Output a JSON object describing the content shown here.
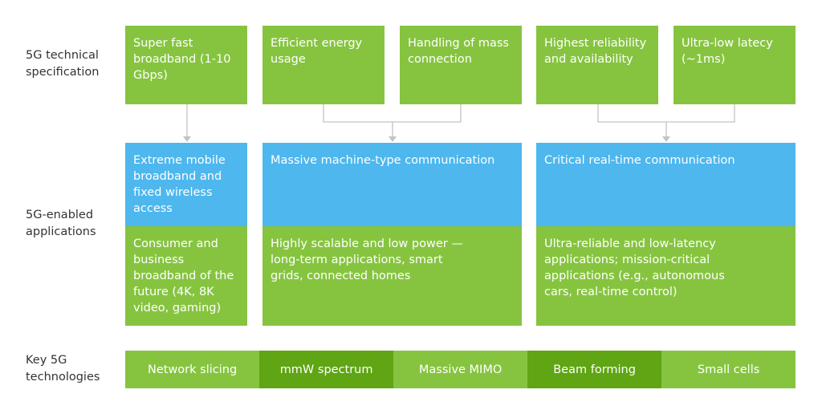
{
  "row_labels": {
    "spec": "5G technical specification",
    "apps": "5G-enabled applications",
    "tech": "Key 5G technologies"
  },
  "specs": [
    "Super fast broadband (1-10 Gbps)",
    "Efficient energy usage",
    "Handling of mass connection",
    "Highest reliability and availability",
    "Ultra-low latecy (~1ms)"
  ],
  "applications": [
    {
      "title": "Extreme mobile broadband and fixed wireless access",
      "detail": "Consumer and business broadband of the future (4K, 8K video, gaming)"
    },
    {
      "title": "Massive machine-type communication",
      "detail": "Highly scalable and low power — long-term applications, smart grids, connected homes"
    },
    {
      "title": "Critical real-time communication",
      "detail": "Ultra-reliable and low-latency applications; mission-critical applications (e.g., autonomous cars, real-time control)"
    }
  ],
  "technologies": [
    "Network slicing",
    "mmW spectrum",
    "Massive MIMO",
    "Beam forming",
    "Small cells"
  ],
  "colors": {
    "green": "#86c440",
    "dark_green": "#5fa514",
    "blue": "#4db7ee",
    "connector": "#c4c4c4"
  }
}
